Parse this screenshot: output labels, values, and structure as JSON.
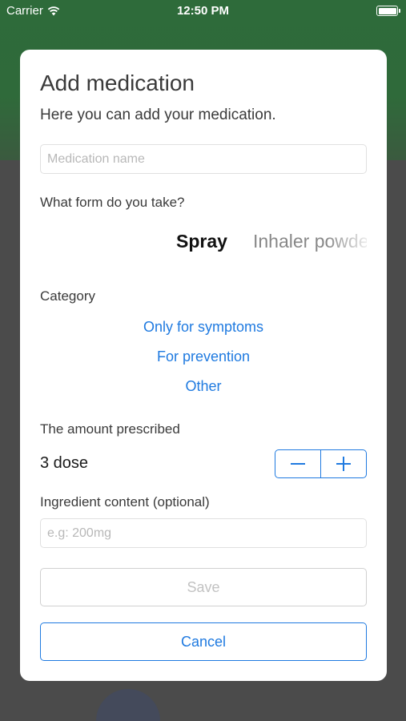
{
  "status_bar": {
    "carrier": "Carrier",
    "time": "12:50 PM"
  },
  "dialog": {
    "title": "Add medication",
    "subtitle": "Here you can add your medication.",
    "medication_name": {
      "value": "",
      "placeholder": "Medication name"
    },
    "form_label": "What form do you take?",
    "form_picker": {
      "selected": "Spray",
      "next": "Inhaler powder"
    },
    "category_label": "Category",
    "category_options": [
      "Only for symptoms",
      "For prevention",
      "Other"
    ],
    "amount_label": "The amount prescribed",
    "amount_value": "3 dose",
    "stepper": {
      "decrement_icon": "minus-icon",
      "increment_icon": "plus-icon"
    },
    "ingredient_label": "Ingredient content (optional)",
    "ingredient": {
      "value": "",
      "placeholder": "e.g: 200mg"
    },
    "save_label": "Save",
    "cancel_label": "Cancel"
  },
  "colors": {
    "accent": "#1f7ae0",
    "disabled": "#c2c2c2",
    "backdrop_top": "#2e6b3a",
    "backdrop_bottom": "#4b4b4b"
  }
}
